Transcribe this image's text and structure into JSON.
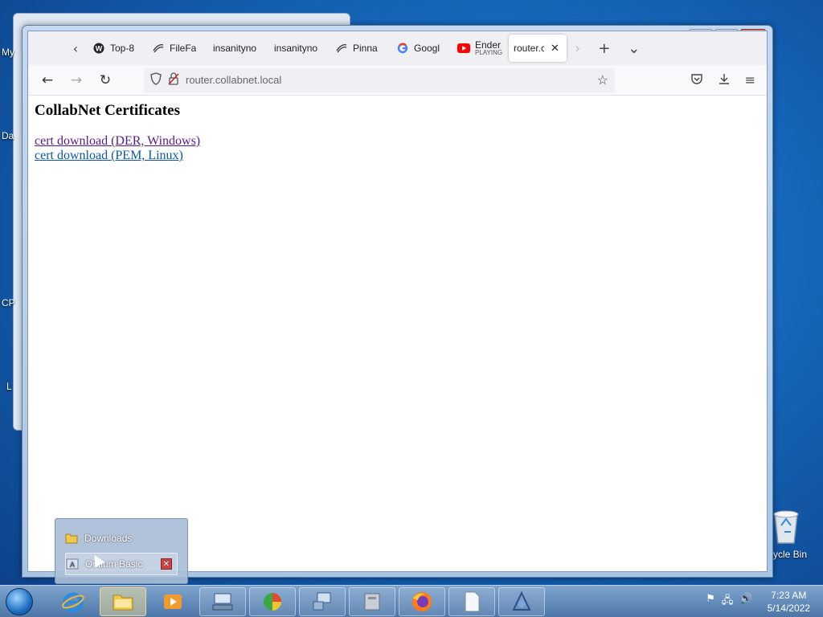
{
  "desktop": {
    "icons_left": [
      "My",
      "Da",
      "CP",
      "L"
    ],
    "recycle_bin_label": "ycle Bin"
  },
  "browser": {
    "tabs": [
      {
        "title": "Top-8",
        "icon": "wordpress-icon"
      },
      {
        "title": "FileFa",
        "icon": "pinnacle-icon"
      },
      {
        "title": "insanityno",
        "icon": "none"
      },
      {
        "title": "insanityno",
        "icon": "none"
      },
      {
        "title": "Pinna",
        "icon": "pinnacle-icon"
      },
      {
        "title": "Googl",
        "icon": "google-icon"
      },
      {
        "title": "Ender",
        "subtitle": "PLAYING",
        "icon": "youtube-icon"
      },
      {
        "title": "router.c",
        "icon": "none",
        "active": true
      }
    ],
    "url_host": "router.collabnet.local"
  },
  "page": {
    "heading": "CollabNet Certificates",
    "links": [
      {
        "text": "cert download (DER, Windows)",
        "visited": true
      },
      {
        "text": "cert download (PEM, Linux)",
        "visited": false
      }
    ]
  },
  "jumplist": {
    "items": [
      "Downloads",
      "Ontium Basic"
    ]
  },
  "taskbar": {
    "clock_time": "7:23 AM",
    "clock_date": "5/14/2022"
  },
  "colors": {
    "visited_link": "#551a8b",
    "link": "#0b57a4",
    "taskbar": "#4c76a8"
  }
}
